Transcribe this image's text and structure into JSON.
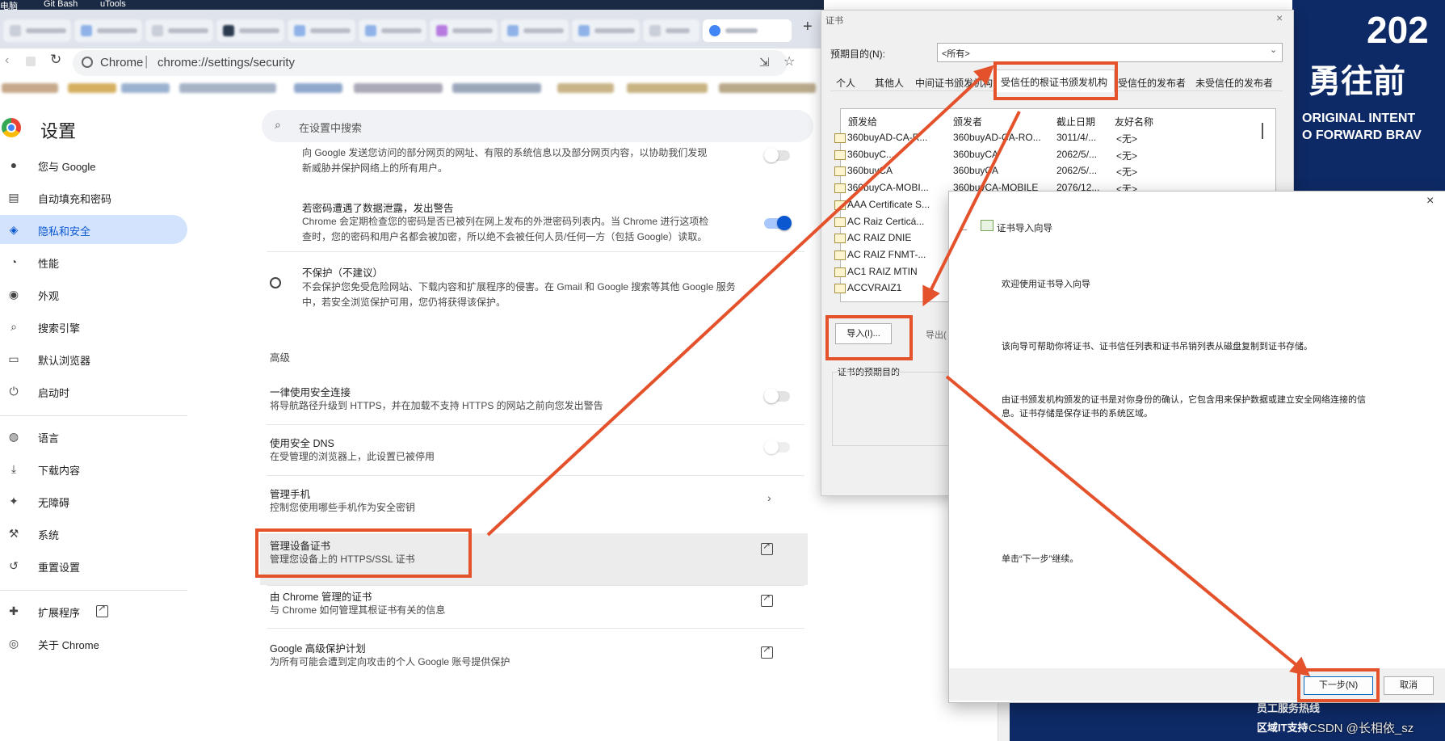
{
  "taskbar": {
    "items": [
      "电脑",
      "Git Bash",
      "uTools"
    ]
  },
  "browser": {
    "omnibox_origin": "Chrome",
    "omnibox_separator": "|",
    "omnibox_url": "chrome://settings/security",
    "new_tab": "+"
  },
  "settings": {
    "title": "设置",
    "search_placeholder": "在设置中搜索",
    "nav": [
      {
        "label": "您与 Google",
        "icon": "person-icon"
      },
      {
        "label": "自动填充和密码",
        "icon": "clipboard-icon"
      },
      {
        "label": "隐私和安全",
        "icon": "shield-icon",
        "active": true
      },
      {
        "label": "性能",
        "icon": "gauge-icon"
      },
      {
        "label": "外观",
        "icon": "palette-icon"
      },
      {
        "label": "搜索引擎",
        "icon": "search-icon"
      },
      {
        "label": "默认浏览器",
        "icon": "browser-icon"
      },
      {
        "label": "启动时",
        "icon": "power-icon"
      },
      {
        "label": "语言",
        "icon": "globe-icon"
      },
      {
        "label": "下载内容",
        "icon": "download-icon"
      },
      {
        "label": "无障碍",
        "icon": "accessibility-icon"
      },
      {
        "label": "系统",
        "icon": "wrench-icon"
      },
      {
        "label": "重置设置",
        "icon": "reset-icon"
      },
      {
        "label": "扩展程序",
        "icon": "puzzle-icon"
      },
      {
        "label": "关于 Chrome",
        "icon": "chrome-icon"
      }
    ],
    "content": {
      "top_desc_1": "向 Google 发送您访问的部分网页的网址、有限的系统信息以及部分网页内容，以协助我们发现",
      "top_desc_2": "新威胁并保护网络上的所有用户。",
      "pw_title": "若密码遭遇了数据泄露，发出警告",
      "pw_desc_1": "Chrome 会定期检查您的密码是否已被列在网上发布的外泄密码列表内。当 Chrome 进行这项检",
      "pw_desc_2": "查时，您的密码和用户名都会被加密，所以绝不会被任何人员/任何一方（包括 Google）读取。",
      "noprotect_title": "不保护（不建议）",
      "noprotect_desc_1": "不会保护您免受危险网站、下载内容和扩展程序的侵害。在 Gmail 和 Google 搜索等其他 Google 服务",
      "noprotect_desc_2": "中，若安全浏览保护可用，您仍将获得该保护。",
      "advanced": "高级",
      "https_title": "一律使用安全连接",
      "https_desc": "将导航路径升级到 HTTPS，并在加载不支持 HTTPS 的网站之前向您发出警告",
      "dns_title": "使用安全 DNS",
      "dns_desc": "在受管理的浏览器上，此设置已被停用",
      "phone_title": "管理手机",
      "phone_desc": "控制您使用哪些手机作为安全密钥",
      "certs_title": "管理设备证书",
      "certs_desc": "管理您设备上的 HTTPS/SSL 证书",
      "chrome_certs_title": "由 Chrome 管理的证书",
      "chrome_certs_desc": "与 Chrome 如何管理其根证书有关的信息",
      "adv_protect_title": "Google 高级保护计划",
      "adv_protect_desc": "为所有可能会遭到定向攻击的个人 Google 账号提供保护"
    }
  },
  "cert_dialog": {
    "title": "证书",
    "purpose_label": "预期目的(N):",
    "purpose_value": "<所有>",
    "tabs": [
      "个人",
      "其他人",
      "中间证书颁发机构",
      "受信任的根证书颁发机构",
      "受信任的发布者",
      "未受信任的发布者"
    ],
    "columns": [
      "颁发给",
      "颁发者",
      "截止日期",
      "友好名称"
    ],
    "rows": [
      {
        "to": "360buyAD-CA-R...",
        "by": "360buyAD-CA-RO...",
        "date": "3011/4/...",
        "name": "<无>"
      },
      {
        "to": "360buyC...",
        "by": "360buyCA",
        "date": "2062/5/...",
        "name": "<无>"
      },
      {
        "to": "360buyCA",
        "by": "360buyCA",
        "date": "2062/5/...",
        "name": "<无>"
      },
      {
        "to": "360buyCA-MOBI...",
        "by": "360buyCA-MOBILE",
        "date": "2076/12...",
        "name": "<无>"
      },
      {
        "to": "AAA Certificate S..."
      },
      {
        "to": "AC Raiz Certicá..."
      },
      {
        "to": "AC RAIZ DNIE"
      },
      {
        "to": "AC RAIZ FNMT-..."
      },
      {
        "to": "AC1 RAIZ MTIN"
      },
      {
        "to": "ACCVRAIZ1"
      }
    ],
    "import_button": "导入(I)...",
    "export_button": "导出(",
    "purposes_label": "证书的预期目的"
  },
  "wizard": {
    "title": "证书导入向导",
    "heading": "欢迎使用证书导入向导",
    "p1": "该向导可帮助你将证书、证书信任列表和证书吊销列表从磁盘复制到证书存储。",
    "p2a": "由证书颁发机构颁发的证书是对你身份的确认，它包含用来保护数据或建立安全网络连接的信",
    "p2b": "息。证书存储是保存证书的系统区域。",
    "p3": "单击“下一步”继续。",
    "next_button": "下一步(N)",
    "cancel_button": "取消",
    "close": "×"
  },
  "poster": {
    "year": "202",
    "slogan": "勇往前",
    "en1": "ORIGINAL INTENT",
    "en2": "O FORWARD BRAV",
    "footer1": "员工服务热线",
    "footer2": "区域IT支持"
  },
  "watermark": "CSDN @长相依_sz",
  "colors": {
    "annotation": "#e4522c",
    "accent": "#0b57d0",
    "nav_active_bg": "#d3e3fd",
    "poster_bg": "#0e2a66"
  }
}
